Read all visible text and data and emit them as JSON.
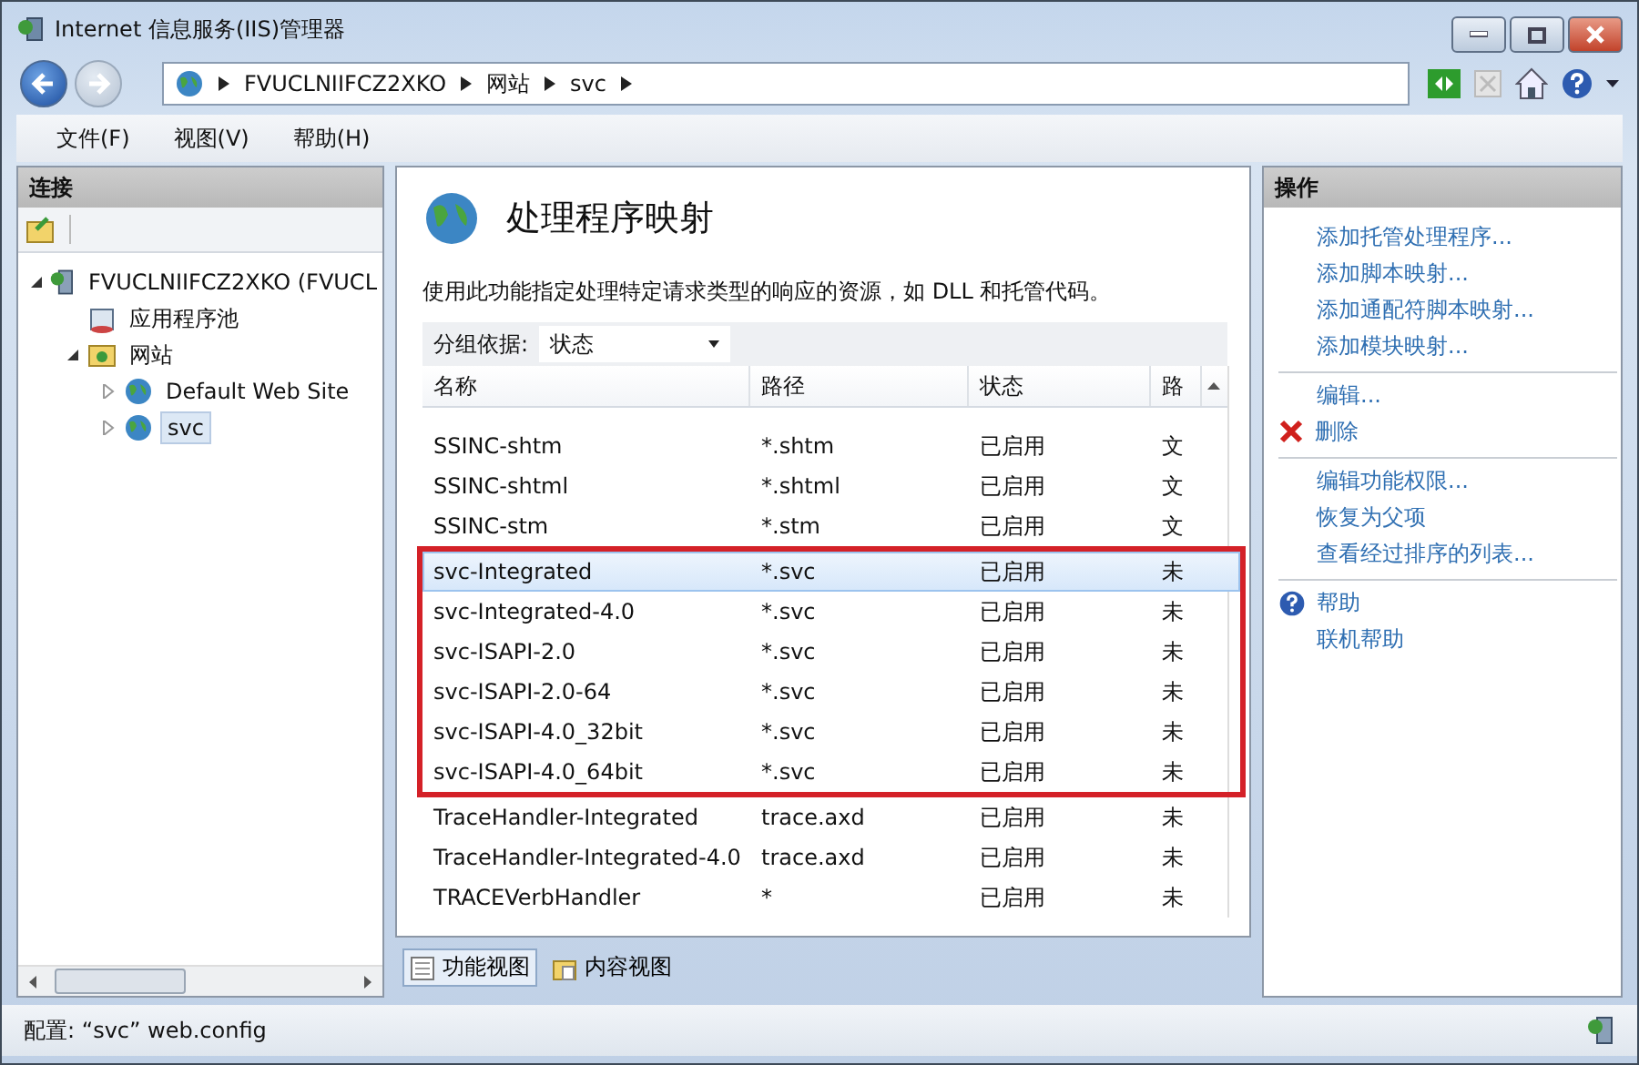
{
  "window": {
    "title": "Internet 信息服务(IIS)管理器"
  },
  "address_bar": {
    "crumbs": [
      "FVUCLNIIFCZ2XKO",
      "网站",
      "svc"
    ]
  },
  "menu": [
    "文件(F)",
    "视图(V)",
    "帮助(H)"
  ],
  "connections": {
    "title": "连接",
    "tree": [
      {
        "label": "FVUCLNIIFCZ2XKO (FVUCL",
        "kind": "server",
        "expanded": true,
        "selected": false,
        "children": [
          {
            "label": "应用程序池",
            "kind": "pool",
            "selected": false
          },
          {
            "label": "网站",
            "kind": "sites",
            "expanded": true,
            "selected": false,
            "children": [
              {
                "label": "Default Web Site",
                "kind": "site",
                "expanded": false,
                "selected": false
              },
              {
                "label": "svc",
                "kind": "site",
                "expanded": false,
                "selected": true
              }
            ]
          }
        ]
      }
    ]
  },
  "feature": {
    "title": "处理程序映射",
    "description": "使用此功能指定处理特定请求类型的响应的资源，如 DLL 和托管代码。",
    "group_by": {
      "label": "分组依据:",
      "value": "状态"
    },
    "table": {
      "columns": [
        "名称",
        "路径",
        "状态",
        "路"
      ],
      "rows": [
        {
          "cells": [
            "SSINC-shtm",
            "*.shtm",
            "已启用",
            "文"
          ],
          "selected": false,
          "highlighted": false
        },
        {
          "cells": [
            "SSINC-shtml",
            "*.shtml",
            "已启用",
            "文"
          ],
          "selected": false,
          "highlighted": false
        },
        {
          "cells": [
            "SSINC-stm",
            "*.stm",
            "已启用",
            "文"
          ],
          "selected": false,
          "highlighted": false
        },
        {
          "cells": [
            "svc-Integrated",
            "*.svc",
            "已启用",
            "未"
          ],
          "selected": true,
          "highlighted": true
        },
        {
          "cells": [
            "svc-Integrated-4.0",
            "*.svc",
            "已启用",
            "未"
          ],
          "selected": false,
          "highlighted": true
        },
        {
          "cells": [
            "svc-ISAPI-2.0",
            "*.svc",
            "已启用",
            "未"
          ],
          "selected": false,
          "highlighted": true
        },
        {
          "cells": [
            "svc-ISAPI-2.0-64",
            "*.svc",
            "已启用",
            "未"
          ],
          "selected": false,
          "highlighted": true
        },
        {
          "cells": [
            "svc-ISAPI-4.0_32bit",
            "*.svc",
            "已启用",
            "未"
          ],
          "selected": false,
          "highlighted": true
        },
        {
          "cells": [
            "svc-ISAPI-4.0_64bit",
            "*.svc",
            "已启用",
            "未"
          ],
          "selected": false,
          "highlighted": true
        },
        {
          "cells": [
            "TraceHandler-Integrated",
            "trace.axd",
            "已启用",
            "未"
          ],
          "selected": false,
          "highlighted": false
        },
        {
          "cells": [
            "TraceHandler-Integrated-4.0",
            "trace.axd",
            "已启用",
            "未"
          ],
          "selected": false,
          "highlighted": false
        },
        {
          "cells": [
            "TRACEVerbHandler",
            "*",
            "已启用",
            "未"
          ],
          "selected": false,
          "highlighted": false
        }
      ]
    },
    "view_tabs": [
      {
        "label": "功能视图",
        "selected": true
      },
      {
        "label": "内容视图",
        "selected": false
      }
    ]
  },
  "actions": {
    "title": "操作",
    "groups": [
      [
        {
          "label": "添加托管处理程序...",
          "kind": "plain"
        },
        {
          "label": "添加脚本映射...",
          "kind": "plain"
        },
        {
          "label": "添加通配符脚本映射...",
          "kind": "plain"
        },
        {
          "label": "添加模块映射...",
          "kind": "plain"
        }
      ],
      [
        {
          "label": "编辑...",
          "kind": "plain"
        },
        {
          "label": "删除",
          "kind": "delete"
        }
      ],
      [
        {
          "label": "编辑功能权限...",
          "kind": "plain"
        },
        {
          "label": "恢复为父项",
          "kind": "plain"
        },
        {
          "label": "查看经过排序的列表...",
          "kind": "plain"
        }
      ],
      [
        {
          "label": "帮助",
          "kind": "help"
        },
        {
          "label": "联机帮助",
          "kind": "plain"
        }
      ]
    ]
  },
  "status_bar": {
    "text": "配置: “svc” web.config"
  }
}
